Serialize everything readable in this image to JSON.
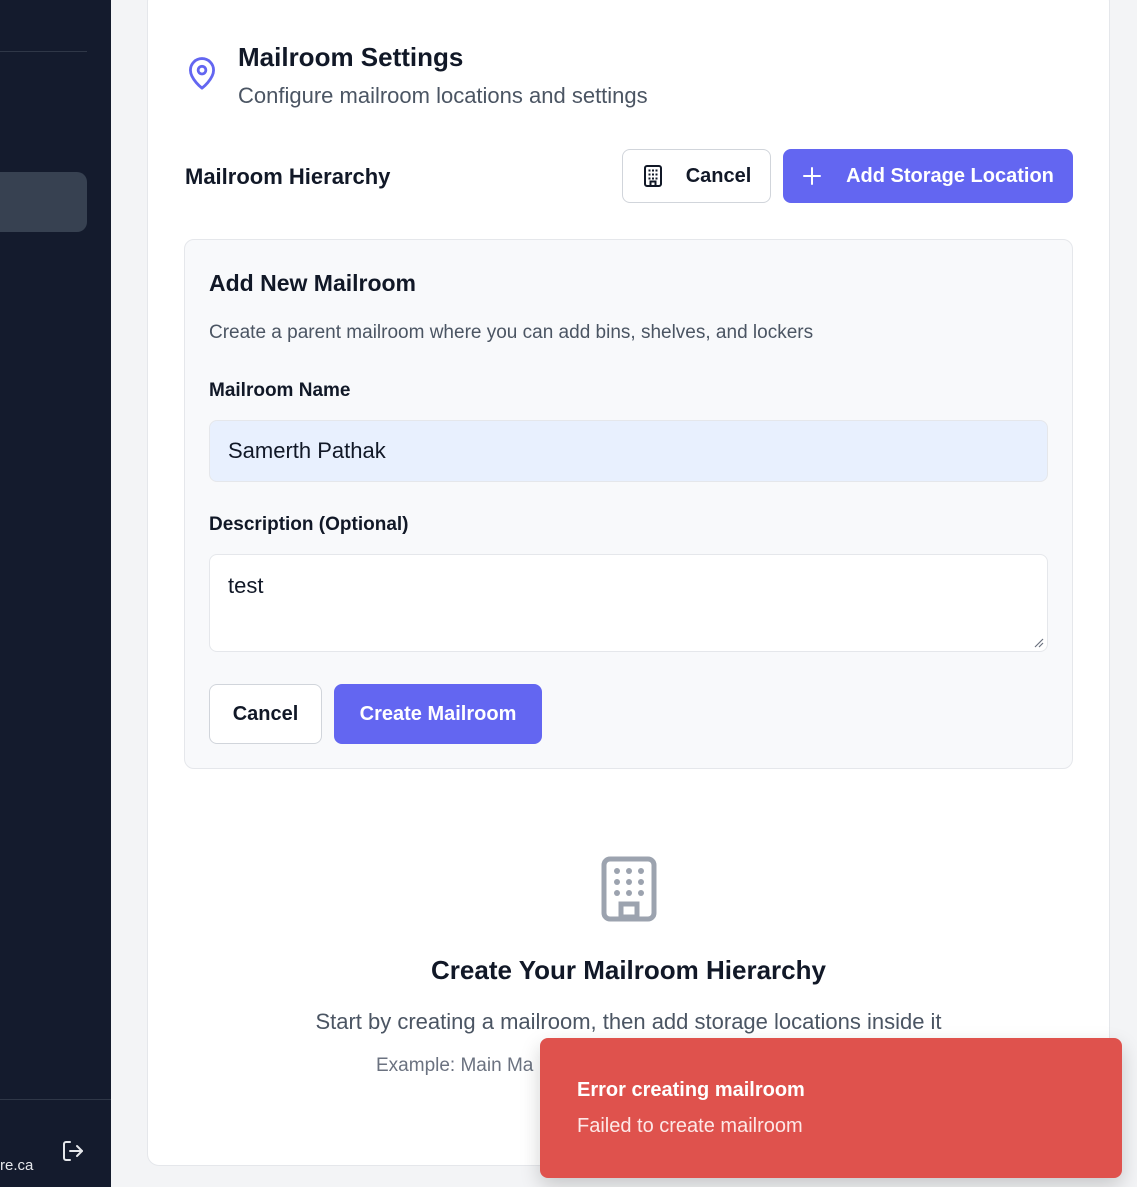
{
  "sidebar": {
    "email_fragment": "re.ca",
    "logout_icon": "logout-icon"
  },
  "header": {
    "title": "Mailroom Settings",
    "subtitle": "Configure mailroom locations and settings",
    "icon": "map-pin-icon"
  },
  "hierarchy": {
    "title": "Mailroom Hierarchy",
    "cancel_label": "Cancel",
    "add_storage_label": "Add Storage Location"
  },
  "form": {
    "title": "Add New Mailroom",
    "description": "Create a parent mailroom where you can add bins, shelves, and lockers",
    "name_label": "Mailroom Name",
    "name_value": "Samerth Pathak",
    "desc_label": "Description (Optional)",
    "desc_value": "test",
    "cancel_label": "Cancel",
    "create_label": "Create Mailroom"
  },
  "empty_state": {
    "title": "Create Your Mailroom Hierarchy",
    "subtitle": "Start by creating a mailroom, then add storage locations inside it",
    "example": "Example: Main Ma"
  },
  "toast": {
    "title": "Error creating mailroom",
    "message": "Failed to create mailroom",
    "color": "#df524d"
  },
  "colors": {
    "accent": "#6366f1",
    "sidebar": "#141b2d"
  }
}
